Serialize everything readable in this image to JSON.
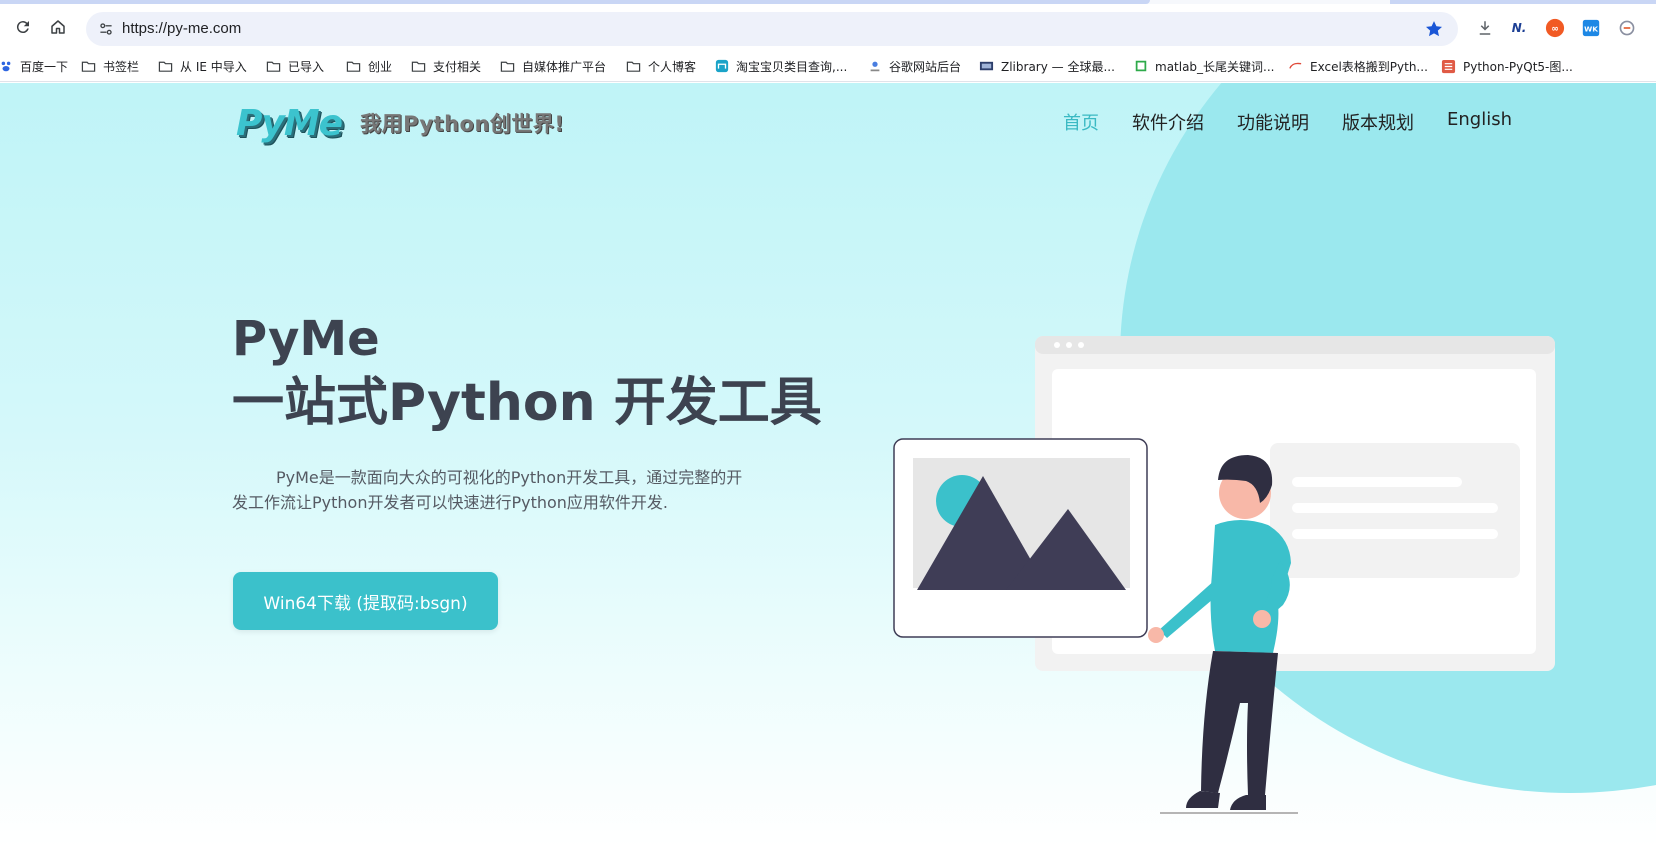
{
  "browser": {
    "url": "https://py-me.com",
    "bookmarks": [
      {
        "label": "百度一下",
        "icon": "paw-icon"
      },
      {
        "label": "书签栏",
        "icon": "folder-icon"
      },
      {
        "label": "从 IE 中导入",
        "icon": "folder-icon"
      },
      {
        "label": "已导入",
        "icon": "folder-icon"
      },
      {
        "label": "创业",
        "icon": "folder-icon"
      },
      {
        "label": "支付相关",
        "icon": "folder-icon"
      },
      {
        "label": "自媒体推广平台",
        "icon": "folder-icon"
      },
      {
        "label": "个人博客",
        "icon": "folder-icon"
      },
      {
        "label": "淘宝宝贝类目查询,...",
        "icon": "taobao-icon"
      },
      {
        "label": "谷歌网站后台",
        "icon": "google-icon"
      },
      {
        "label": "Zlibrary — 全球最...",
        "icon": "zlibrary-icon"
      },
      {
        "label": "matlab_长尾关键词...",
        "icon": "matlab-icon"
      },
      {
        "label": "Excel表格搬到Pyth...",
        "icon": "csdn-icon"
      },
      {
        "label": "Python-PyQt5-图...",
        "icon": "jianshu-icon"
      }
    ]
  },
  "site": {
    "logo_text": "PyMe",
    "slogan": "我用Python创世界!",
    "nav": [
      {
        "label": "首页",
        "active": true
      },
      {
        "label": "软件介绍",
        "active": false
      },
      {
        "label": "功能说明",
        "active": false
      },
      {
        "label": "版本规划",
        "active": false
      },
      {
        "label": "English",
        "active": false
      }
    ]
  },
  "hero": {
    "title_line1": "PyMe",
    "title_line2": "一站式Python 开发工具",
    "description": "PyMe是一款面向大众的可视化的Python开发工具，通过完整的开发工作流让Python开发者可以快速进行Python应用软件开发.",
    "download_label": "Win64下载 (提取码:bsgn)"
  },
  "colors": {
    "accent": "#3bc1cb",
    "nav_active": "#3ab9c3",
    "circle": "#9be8ee",
    "title": "#3d4350"
  }
}
